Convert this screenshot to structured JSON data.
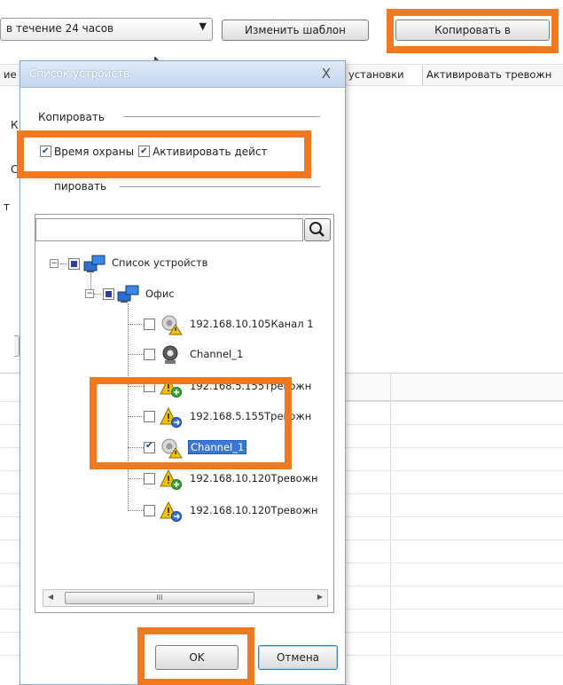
{
  "background": {
    "period_combo": {
      "value": "в течение 24 часов"
    },
    "edit_template_label": "Изменить шаблон",
    "copy_to_label": "Копировать в",
    "tab_fragment_left": "ие",
    "tab_presets_label": "установки",
    "tab_activate_alarm_label": "Активировать тревожн",
    "partial_k": "К",
    "partial_c": "С",
    "partial_t": "т"
  },
  "dialog": {
    "title": "Список устройств",
    "close_glyph": "X",
    "copy_section_label": "Копировать",
    "checkbox_guard_time": {
      "label": "Время охраны",
      "checked": true
    },
    "checkbox_activate_action": {
      "label": "Активировать дейст",
      "checked": true
    },
    "copy_target_label": "пировать",
    "search": {
      "value": "",
      "placeholder": ""
    },
    "tree": {
      "root": {
        "label": "Список устройств"
      },
      "group": {
        "label": "Офис"
      },
      "items": [
        {
          "label": "192.168.10.105Канал 1",
          "icon": "camera-warning-icon",
          "checked": false,
          "selected": false
        },
        {
          "label": "Channel_1",
          "icon": "camera-icon",
          "checked": false,
          "selected": false
        },
        {
          "label": "192.168.5.155Тревожн",
          "icon": "alarm-input-icon",
          "checked": false,
          "selected": false
        },
        {
          "label": "192.168.5.155Тревожн",
          "icon": "alarm-output-icon",
          "checked": false,
          "selected": false
        },
        {
          "label": "Channel_1",
          "icon": "camera-warning-icon",
          "checked": true,
          "selected": true
        },
        {
          "label": "192.168.10.120Тревожн",
          "icon": "alarm-input-icon",
          "checked": false,
          "selected": false
        },
        {
          "label": "192.168.10.120Тревожн",
          "icon": "alarm-output-icon",
          "checked": false,
          "selected": false
        }
      ]
    },
    "scrollbar_thumb_glyph": "III",
    "ok_label": "OK",
    "cancel_label": "Отмена"
  },
  "colors": {
    "highlight": "#f07a1f",
    "selection": "#3a78d8",
    "title_bar": "#c4d8ee"
  }
}
